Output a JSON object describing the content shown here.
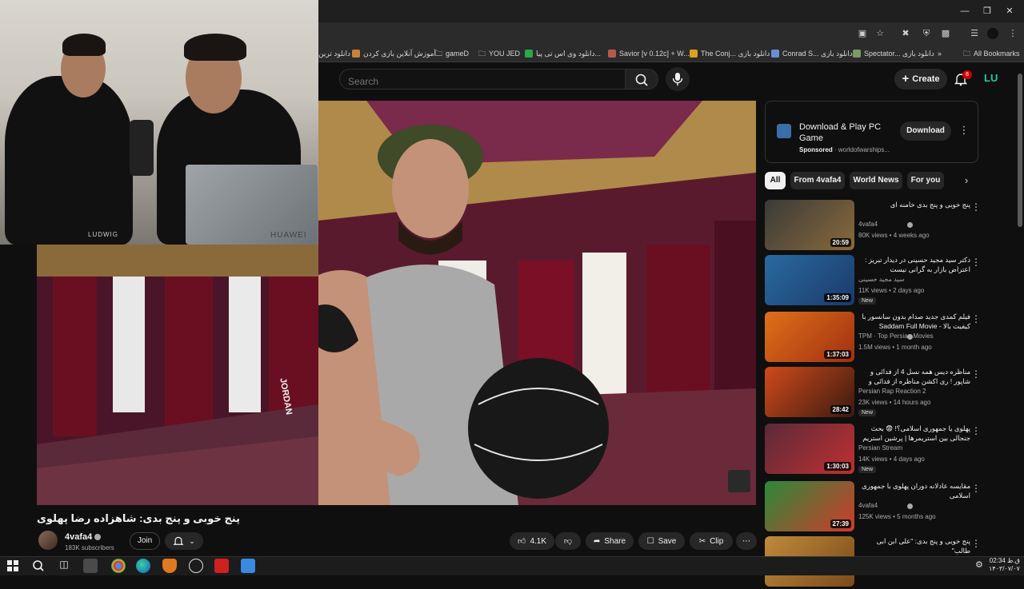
{
  "browser": {
    "bookmarks": [
      {
        "label": "دانلود ترین",
        "color": "#d6a04a"
      },
      {
        "label": "آموزش آنلاین بازی کردن...",
        "color": "#c8813a"
      },
      {
        "label": "gameD",
        "color": "#9a9a9a"
      },
      {
        "label": "YOU JED",
        "color": "#9a9a9a"
      },
      {
        "label": "دانلود وی اس تی پیا...",
        "color": "#2aa84a"
      },
      {
        "label": "Savior [v 0.12c] + W...",
        "color": "#b55a4a"
      },
      {
        "label": "The Conj... دانلود بازی",
        "color": "#e0a020"
      },
      {
        "label": "Conrad S... دانلود بازی",
        "color": "#6a8fd0"
      },
      {
        "label": "Spectator... دانلود بازی",
        "color": "#7a9a6a"
      }
    ],
    "all_bookmarks_label": "All Bookmarks"
  },
  "header": {
    "search_placeholder": "Search",
    "create_label": "Create",
    "notification_count": "8",
    "avatar_initials": "LU"
  },
  "webcam": {
    "laptop_brand": "HUAWEI",
    "mic_brand": "LUDWIG"
  },
  "video": {
    "title": "پنج خوبی و پنج بدی: شاهزاده رضا پهلوی",
    "shirt_text": "JORDAN",
    "channel_name": "4vafa4",
    "subscribers": "183K subscribers",
    "join_label": "Join",
    "likes": "4.1K",
    "share_label": "Share",
    "save_label": "Save",
    "clip_label": "Clip"
  },
  "ad": {
    "title": "Download & Play PC Game",
    "sponsored": "Sponsored",
    "domain": "worldofwarships...",
    "button": "Download"
  },
  "chips": [
    "All",
    "From 4vafa4",
    "World News",
    "For you"
  ],
  "recommendations": [
    {
      "title": "پنج خوبی و پنج بدی خامنه ای",
      "channel": "4vafa4",
      "verified": true,
      "stats": "80K views • 4 weeks ago",
      "duration": "20:59",
      "new": "",
      "thumb": [
        "#3a3a3a",
        "#8a6a3a"
      ]
    },
    {
      "title": "دکتر سید مجید حسینی در دیدار تبریز : اعتراض بازار به گرانی نیست",
      "channel": "سید مجید حسینی",
      "verified": false,
      "stats": "11K views • 2 days ago",
      "duration": "1:35:09",
      "new": "New",
      "thumb": [
        "#2a6aa0",
        "#1a3a6a"
      ]
    },
    {
      "title": "فیلم کمدی جدید صدام بدون سانسور با کیفیت بالا - Saddam Full Movie",
      "channel": "TPM · Top Persian Movies",
      "verified": true,
      "stats": "1.5M views • 1 month ago",
      "duration": "1:37:03",
      "new": "",
      "thumb": [
        "#e0701a",
        "#a03010"
      ]
    },
    {
      "title": "مناظره دیس همه نسل 4 از فدائی و شاپور ! ری اکشن مناظره از فدائی و شاپور 🔥🎤",
      "channel": "Persian Rap Reaction 2",
      "verified": false,
      "stats": "23K views • 14 hours ago",
      "duration": "28:42",
      "new": "New",
      "thumb": [
        "#d04a1a",
        "#3a1a10"
      ]
    },
    {
      "title": "پهلوی یا جمهوری اسلامی؟! 😨 بحث جنجالی بین استریمرها | پرشین استریم قسمت",
      "channel": "Persian Stream",
      "verified": false,
      "stats": "14K views • 4 days ago",
      "duration": "1:30:03",
      "new": "New",
      "thumb": [
        "#5a2a3a",
        "#c03030"
      ]
    },
    {
      "title": "مقایسه عادلانه دوران پهلوی با جمهوری اسلامی",
      "channel": "4vafa4",
      "verified": true,
      "stats": "125K views • 5 months ago",
      "duration": "27:39",
      "new": "",
      "thumb": [
        "#2a8a3a",
        "#d03a2a"
      ]
    },
    {
      "title": "پنج خوبی و پنج بدی: \"علی ابن ابی طالب\"",
      "channel": "4vafa4",
      "verified": true,
      "stats": "",
      "duration": "",
      "new": "",
      "thumb": [
        "#c08a3a",
        "#7a4a1a"
      ]
    }
  ],
  "taskbar": {
    "time": "02:34 ق.ظ",
    "date": "۱۴۰۳/۰۷/۰۷"
  },
  "colors": {
    "background": "#0f0f0f",
    "accent_red": "#cc0000",
    "chip_bg": "#272727"
  }
}
